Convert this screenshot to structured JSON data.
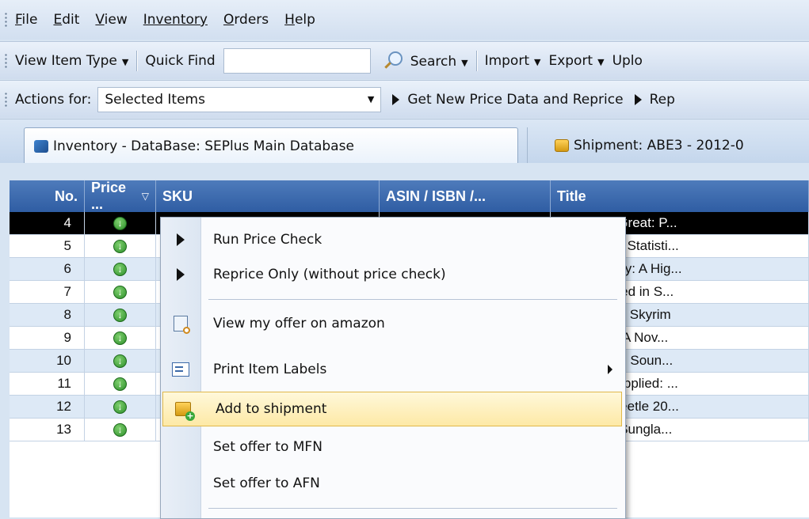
{
  "menubar": {
    "items": [
      {
        "label": "File",
        "accel": "F",
        "rest": "ile"
      },
      {
        "label": "Edit",
        "accel": "E",
        "rest": "dit"
      },
      {
        "label": "View",
        "accel": "V",
        "rest": "iew"
      },
      {
        "label": "Inventory",
        "accel": "",
        "rest": "Inventory"
      },
      {
        "label": "Orders",
        "accel": "O",
        "rest": "rders"
      },
      {
        "label": "Help",
        "accel": "H",
        "rest": "elp"
      }
    ]
  },
  "toolbar1": {
    "view_item_type": "View Item Type",
    "quick_find_label": "Quick Find",
    "quick_find_value": "",
    "search": "Search",
    "import": "Import",
    "export": "Export",
    "upload": "Uplo"
  },
  "toolbar2": {
    "actions_label": "Actions for:",
    "actions_selected": "Selected Items",
    "get_new_price": "Get New Price Data and Reprice",
    "rep": "Rep"
  },
  "tabs": [
    {
      "label": "Inventory - DataBase: SEPlus Main Database",
      "icon": "database-icon"
    },
    {
      "label": "Shipment: ABE3 - 2012-0",
      "icon": "shipment-box-icon"
    }
  ],
  "grid": {
    "columns": [
      "No.",
      "Price ...",
      "SKU",
      "ASIN / ISBN /...",
      "Title"
    ],
    "rows": [
      {
        "no": "4",
        "title": "herine the Great: P..."
      },
      {
        "no": "5",
        "title": "merical and Statisti..."
      },
      {
        "no": "6",
        "title": "axy 2 Galaxy: A Hig..."
      },
      {
        "no": "7",
        "title": "sons Learned in S..."
      },
      {
        "no": "8",
        "title": "er Scrolls V: Skyrim"
      },
      {
        "no": "9",
        "title": "Gold Mine: A Nov..."
      },
      {
        "no": "10",
        "title": "uto: Original Soun..."
      },
      {
        "no": "11",
        "title": "er Stories Applied: ..."
      },
      {
        "no": "12",
        "title": "kswagen Beetle 20..."
      },
      {
        "no": "13",
        "title": "o Explorer Sungla..."
      }
    ]
  },
  "context_menu": {
    "items": [
      {
        "label": "Run Price Check",
        "icon": "play-icon"
      },
      {
        "label": "Reprice Only (without price check)",
        "icon": "play-icon"
      },
      {
        "label": "View my offer on amazon",
        "icon": "view-offer-icon"
      },
      {
        "label": "Print Item Labels",
        "icon": "print-labels-icon"
      },
      {
        "label": "Add to shipment",
        "icon": "add-shipment-icon"
      },
      {
        "label": "Set offer to MFN",
        "icon": ""
      },
      {
        "label": "Set offer to AFN",
        "icon": ""
      }
    ]
  },
  "colors": {
    "header_bg": "#2f5da3",
    "row_alt": "#dde9f6",
    "menu_highlight": "#fde9a6"
  }
}
